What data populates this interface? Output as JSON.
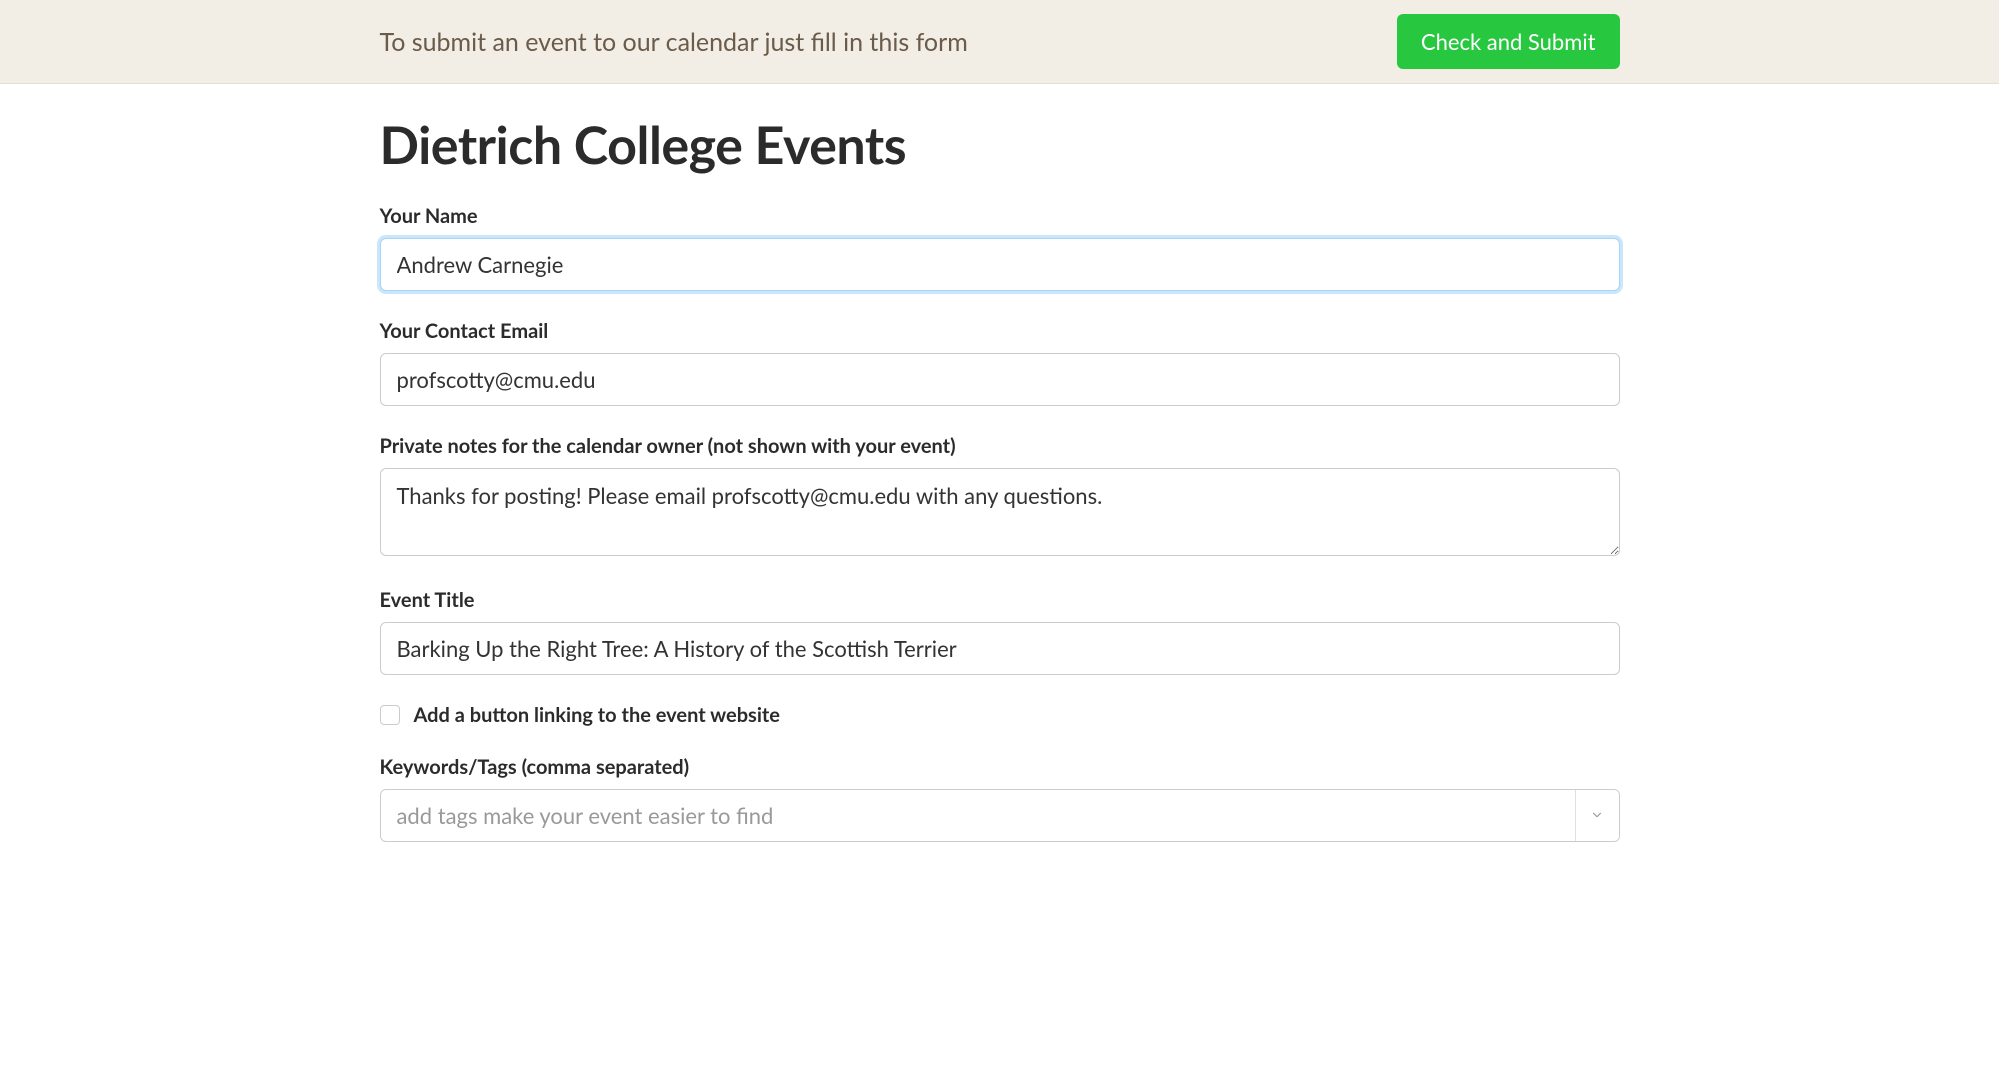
{
  "top_bar": {
    "instruction": "To submit an event to our calendar just fill in this form",
    "submit_label": "Check and Submit"
  },
  "page_title": "Dietrich College Events",
  "form": {
    "name": {
      "label": "Your Name",
      "value": "Andrew Carnegie"
    },
    "email": {
      "label": "Your Contact Email",
      "value": "profscotty@cmu.edu"
    },
    "private_notes": {
      "label": "Private notes for the calendar owner (not shown with your event)",
      "value": "Thanks for posting! Please email profscotty@cmu.edu with any questions."
    },
    "event_title": {
      "label": "Event Title",
      "value": "Barking Up the Right Tree: A History of the Scottish Terrier"
    },
    "website_button": {
      "label": "Add a button linking to the event website",
      "checked": false
    },
    "tags": {
      "label": "Keywords/Tags (comma separated)",
      "placeholder": "add tags make your event easier to find",
      "value": ""
    }
  }
}
